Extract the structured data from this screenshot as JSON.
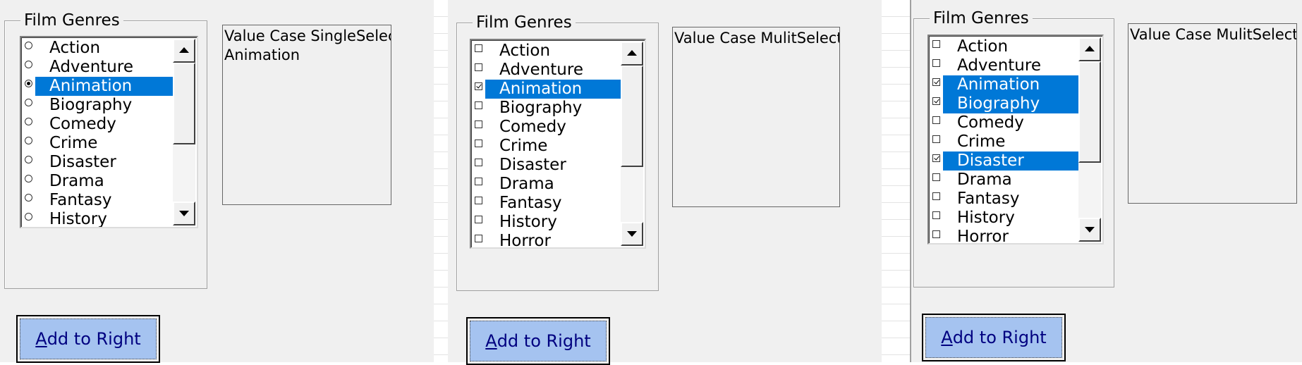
{
  "panels": [
    {
      "id": "single",
      "frame_title": "Film Genres",
      "mark_type": "radio",
      "items": [
        {
          "label": "Action",
          "selected": false
        },
        {
          "label": "Adventure",
          "selected": false
        },
        {
          "label": "Animation",
          "selected": true
        },
        {
          "label": "Biography",
          "selected": false
        },
        {
          "label": "Comedy",
          "selected": false
        },
        {
          "label": "Crime",
          "selected": false
        },
        {
          "label": "Disaster",
          "selected": false
        },
        {
          "label": "Drama",
          "selected": false
        },
        {
          "label": "Fantasy",
          "selected": false
        },
        {
          "label": "History",
          "selected": false
        }
      ],
      "value_lines": [
        "Value Case SingleSelect",
        "Animation"
      ],
      "button": {
        "accel": "A",
        "rest": "dd to Right"
      }
    },
    {
      "id": "multi-1",
      "frame_title": "Film Genres",
      "mark_type": "check",
      "items": [
        {
          "label": "Action",
          "selected": false
        },
        {
          "label": "Adventure",
          "selected": false
        },
        {
          "label": "Animation",
          "selected": true
        },
        {
          "label": "Biography",
          "selected": false
        },
        {
          "label": "Comedy",
          "selected": false
        },
        {
          "label": "Crime",
          "selected": false
        },
        {
          "label": "Disaster",
          "selected": false
        },
        {
          "label": "Drama",
          "selected": false
        },
        {
          "label": "Fantasy",
          "selected": false
        },
        {
          "label": "History",
          "selected": false
        },
        {
          "label": "Horror",
          "selected": false
        }
      ],
      "value_lines": [
        "Value Case MulitSelect"
      ],
      "button": {
        "accel": "A",
        "rest": "dd to Right"
      }
    },
    {
      "id": "multi-2",
      "frame_title": "Film Genres",
      "mark_type": "check",
      "items": [
        {
          "label": "Action",
          "selected": false
        },
        {
          "label": "Adventure",
          "selected": false
        },
        {
          "label": "Animation",
          "selected": true
        },
        {
          "label": "Biography",
          "selected": true
        },
        {
          "label": "Comedy",
          "selected": false
        },
        {
          "label": "Crime",
          "selected": false
        },
        {
          "label": "Disaster",
          "selected": true
        },
        {
          "label": "Drama",
          "selected": false
        },
        {
          "label": "Fantasy",
          "selected": false
        },
        {
          "label": "History",
          "selected": false
        },
        {
          "label": "Horror",
          "selected": false
        }
      ],
      "value_lines": [
        "Value Case MulitSelect"
      ],
      "button": {
        "accel": "A",
        "rest": "dd to Right"
      }
    }
  ],
  "colors": {
    "selection": "#0078d7",
    "button_face": "#a5c3f0",
    "button_text": "#000080",
    "panel_bg": "#f0f0f0"
  },
  "icons": [
    "scroll-up-arrow-icon",
    "scroll-down-arrow-icon",
    "radio-icon",
    "checkbox-icon"
  ]
}
